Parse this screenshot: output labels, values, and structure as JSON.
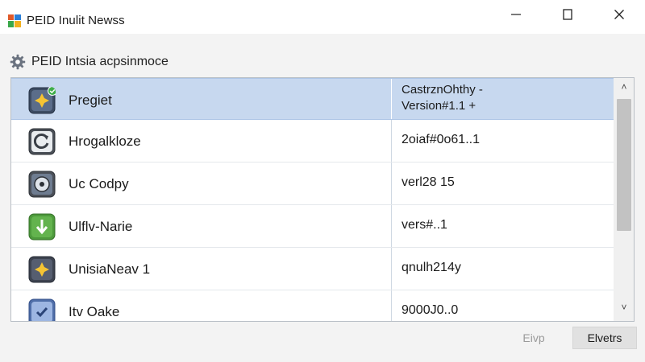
{
  "window": {
    "title": "PEID Inulit Newss",
    "icon": "app-logo-icon",
    "controls": [
      "minimize-icon",
      "maximize-icon",
      "close-icon"
    ]
  },
  "section": {
    "title": "PEID Intsia acpsinmoce",
    "icon": "gear-icon"
  },
  "list": {
    "rows": [
      {
        "name": "Pregiet",
        "version": "CastrznOhthy -",
        "version_line2": "Version#1.1 +",
        "icon": "plus-check-icon",
        "selected": true
      },
      {
        "name": "Hrogalkloze",
        "version": "2oiaf#0o61..1",
        "icon": "refresh-icon",
        "selected": false
      },
      {
        "name": "Uc Codpy",
        "version": "verl28 15",
        "icon": "disc-icon",
        "selected": false
      },
      {
        "name": "Ulflv-Narie",
        "version": "vers#..1",
        "icon": "download-arrow-icon",
        "selected": false
      },
      {
        "name": "UnisiaNeav 1",
        "version": "qnulh214y",
        "icon": "plus-icon",
        "selected": false
      },
      {
        "name": "Itv Oake",
        "version": "9000J0..0",
        "icon": "shield-check-icon",
        "selected": false
      }
    ]
  },
  "scrollbar": {
    "up_glyph": "˄",
    "down_glyph": "˅"
  },
  "footer": {
    "secondary_label": "Eivp",
    "primary_label": "Elvetrs"
  },
  "colors": {
    "selection": "#c7d8ef",
    "panel_border": "#b9bfc6"
  }
}
